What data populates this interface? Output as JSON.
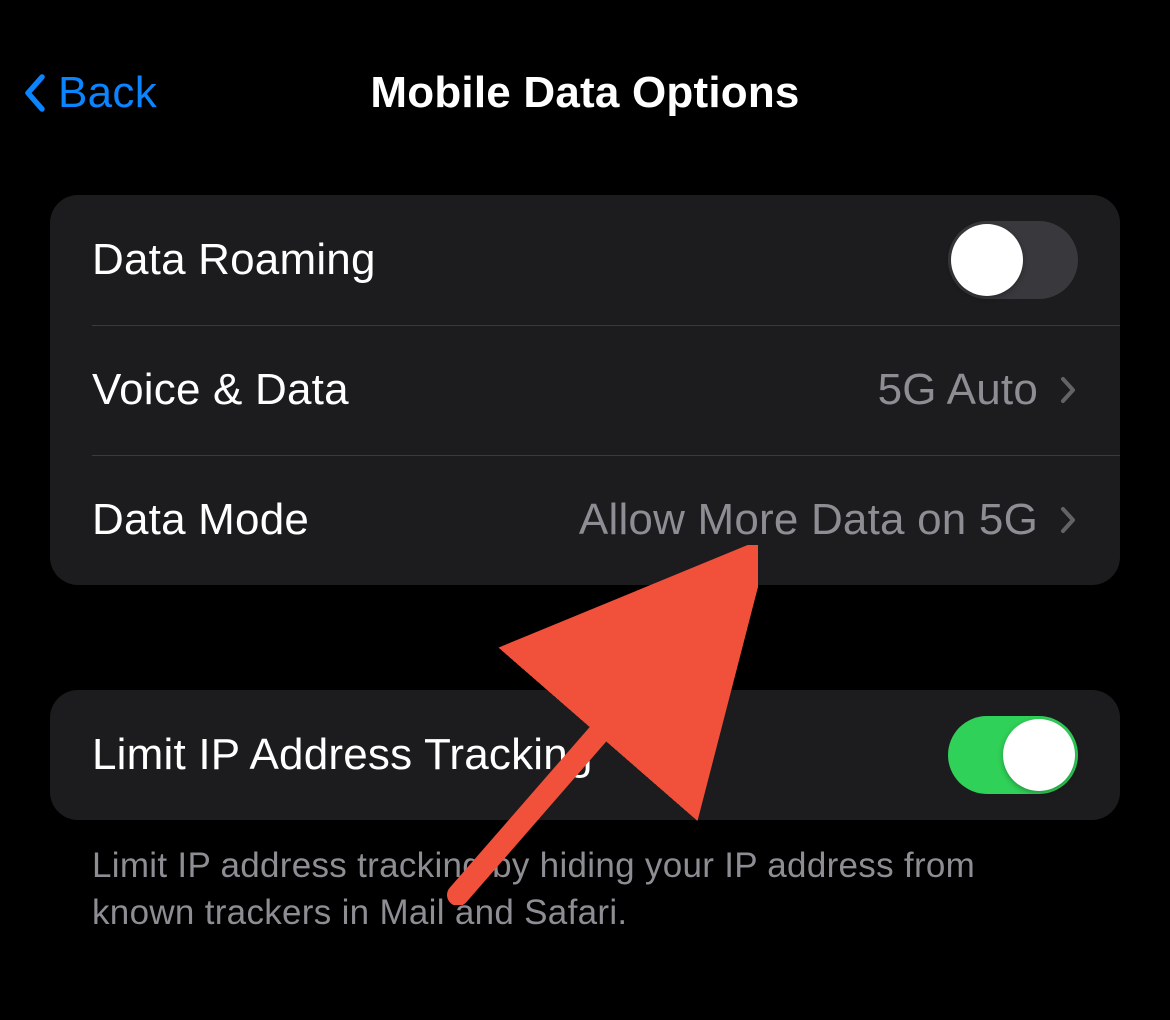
{
  "nav": {
    "back_label": "Back",
    "title": "Mobile Data Options"
  },
  "group1": {
    "data_roaming": {
      "label": "Data Roaming",
      "on": false
    },
    "voice_data": {
      "label": "Voice & Data",
      "value": "5G Auto"
    },
    "data_mode": {
      "label": "Data Mode",
      "value": "Allow More Data on 5G"
    }
  },
  "group2": {
    "limit_ip": {
      "label": "Limit IP Address Tracking",
      "on": true
    },
    "footer": "Limit IP address tracking by hiding your IP address from known trackers in Mail and Safari."
  },
  "colors": {
    "accent": "#0a84ff",
    "toggle_on": "#30d158",
    "arrow": "#f1513b"
  }
}
